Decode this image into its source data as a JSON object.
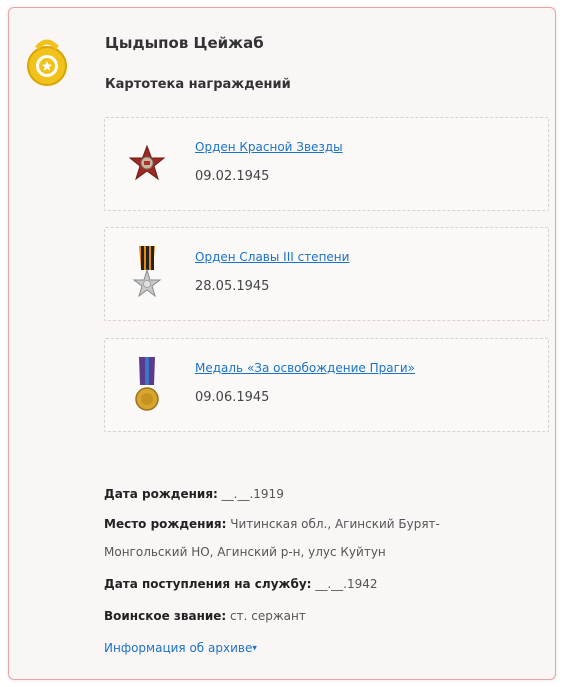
{
  "person": {
    "name": "Цыдыпов Цейжаб",
    "section_title": "Картотека награждений"
  },
  "colors": {
    "accent_link": "#1a73c9",
    "card_border": "#e3a8a3",
    "header_medal": "#e7b700"
  },
  "awards": [
    {
      "name": "Орден Красной Звезды",
      "date": "09.02.1945",
      "icon": "red-star-order-icon"
    },
    {
      "name": "Орден Славы III степени",
      "date": "28.05.1945",
      "icon": "order-of-glory-icon"
    },
    {
      "name": "Медаль «За освобождение Праги»",
      "date": "09.06.1945",
      "icon": "prague-liberation-medal-icon"
    }
  ],
  "info": {
    "birth_date_label": "Дата рождения:",
    "birth_date_value": "__.__.1919",
    "birth_place_label": "Место рождения:",
    "birth_place_line1": "Читинская обл., Агинский Бурят-",
    "birth_place_line2": "Монгольский НО, Агинский р-н, улус Куйтун",
    "service_date_label": "Дата поступления на службу:",
    "service_date_value": "__.__.1942",
    "rank_label": "Воинское звание:",
    "rank_value": "ст. сержант",
    "archive_link": "Информация об архиве"
  }
}
